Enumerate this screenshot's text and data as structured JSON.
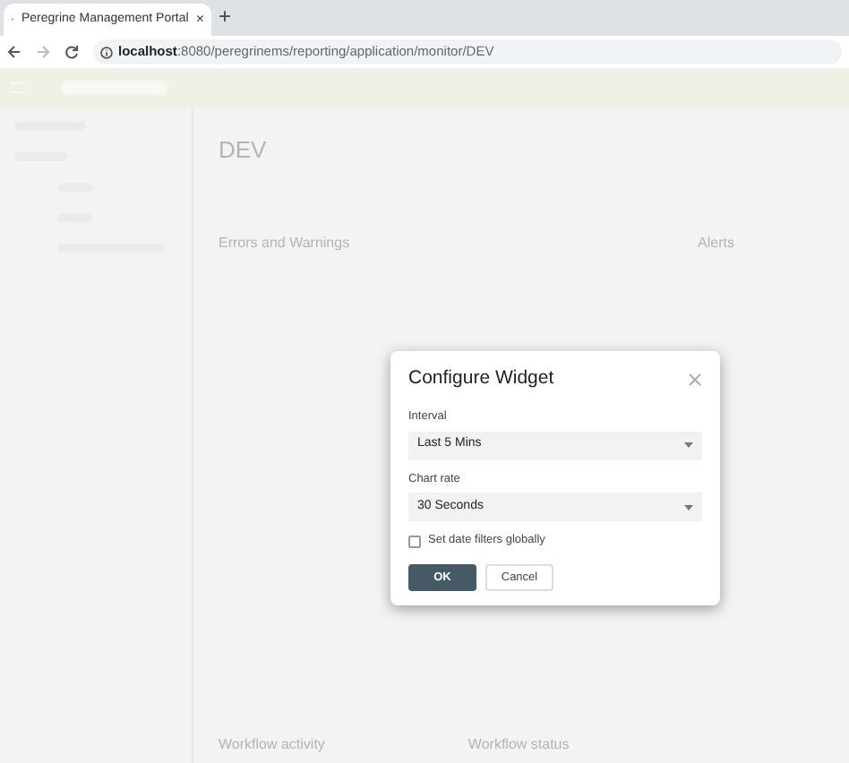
{
  "browser": {
    "tab_title": "Peregrine Management Portal",
    "new_tab": "+",
    "close_tab": "×",
    "url_host": "localhost",
    "url_path": ":8080/peregrinems/reporting/application/monitor/DEV"
  },
  "page": {
    "heading": "DEV",
    "cards": [
      {
        "title": "Errors and Warnings"
      },
      {
        "title": "Alerts"
      }
    ],
    "bottom_cards": [
      {
        "title": "Workflow activity"
      },
      {
        "title": "Workflow status"
      }
    ]
  },
  "dialog": {
    "title": "Configure Widget",
    "fields": [
      {
        "label": "Interval",
        "value": "Last 5 Mins"
      },
      {
        "label": "Chart rate",
        "value": "30 Seconds"
      }
    ],
    "checkbox": {
      "label": "Set date filters globally",
      "checked": false
    },
    "buttons": [
      {
        "label": "OK",
        "kind": "primary"
      },
      {
        "label": "Cancel",
        "kind": "secondary"
      }
    ]
  }
}
